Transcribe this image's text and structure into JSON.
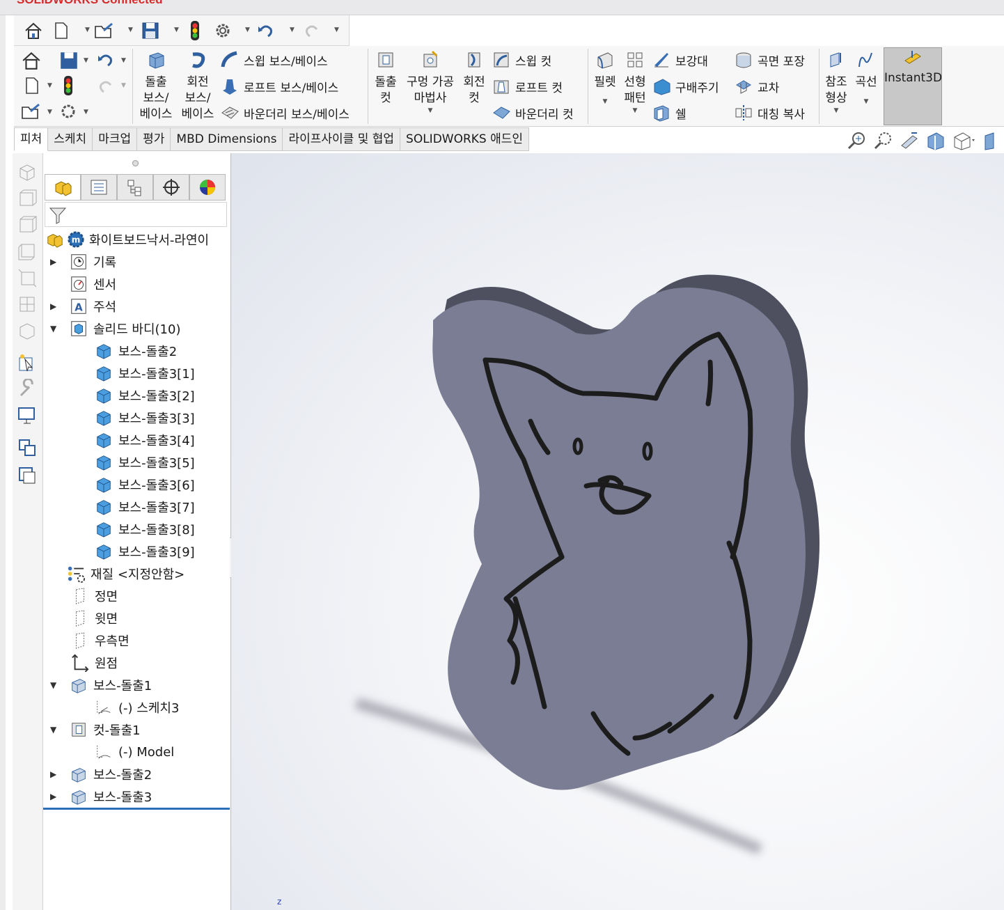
{
  "app": {
    "brand": "SOLIDWORKS Connected"
  },
  "quick_access": {
    "icons": [
      "home-icon",
      "new-document-icon",
      "open-icon",
      "save-icon",
      "rebuild-traffic-light-icon",
      "options-gear-icon",
      "undo-icon",
      "redo-icon"
    ]
  },
  "ribbon": {
    "extruded_boss": "돌출\n보스/\n베이스",
    "revolved_boss": "회전\n보스/\n베이스",
    "swept_boss": "스윕 보스/베이스",
    "lofted_boss": "로프트 보스/베이스",
    "boundary_boss": "바운더리 보스/베이스",
    "extruded_cut": "돌출\n컷",
    "hole_wizard": "구멍 가공\n마법사",
    "revolved_cut": "회전\n컷",
    "swept_cut": "스윕 컷",
    "lofted_cut": "로프트 컷",
    "boundary_cut": "바운더리 컷",
    "fillet": "필렛",
    "linear_pattern": "선형\n패턴",
    "rib": "보강대",
    "draft": "구배주기",
    "shell": "쉘",
    "wrap": "곡면 포장",
    "intersect": "교차",
    "mirror": "대칭 복사",
    "reference_geometry": "참조\n형상",
    "curves": "곡선",
    "instant3d": "Instant3D"
  },
  "tabs": [
    {
      "label": "피처",
      "active": true
    },
    {
      "label": "스케치",
      "active": false
    },
    {
      "label": "마크업",
      "active": false
    },
    {
      "label": "평가",
      "active": false
    },
    {
      "label": "MBD Dimensions",
      "active": false
    },
    {
      "label": "라이프사이클 및 협업",
      "active": false
    },
    {
      "label": "SOLIDWORKS 애드인",
      "active": false
    }
  ],
  "feature_tree": {
    "part_name": "화이트보드낙서-라연이",
    "history": "기록",
    "sensors": "센서",
    "annotations": "주석",
    "solid_bodies": "솔리드 바디(10)",
    "bodies": [
      "보스-돌출2",
      "보스-돌출3[1]",
      "보스-돌출3[2]",
      "보스-돌출3[3]",
      "보스-돌출3[4]",
      "보스-돌출3[5]",
      "보스-돌출3[6]",
      "보스-돌출3[7]",
      "보스-돌출3[8]",
      "보스-돌출3[9]"
    ],
    "material": "재질 <지정안함>",
    "front_plane": "정면",
    "top_plane": "윗면",
    "right_plane": "우측면",
    "origin": "원점",
    "boss_extrude1": "보스-돌출1",
    "sketch3": "(-) 스케치3",
    "cut_extrude1": "컷-돌출1",
    "model_sketch": "(-) Model",
    "boss_extrude2": "보스-돌출2",
    "boss_extrude3": "보스-돌출3"
  },
  "viewport": {
    "axis_label": "z",
    "part_color": "#7a7d93",
    "part_edge_color": "#4e5060",
    "outline_color": "#1c1c1c"
  }
}
